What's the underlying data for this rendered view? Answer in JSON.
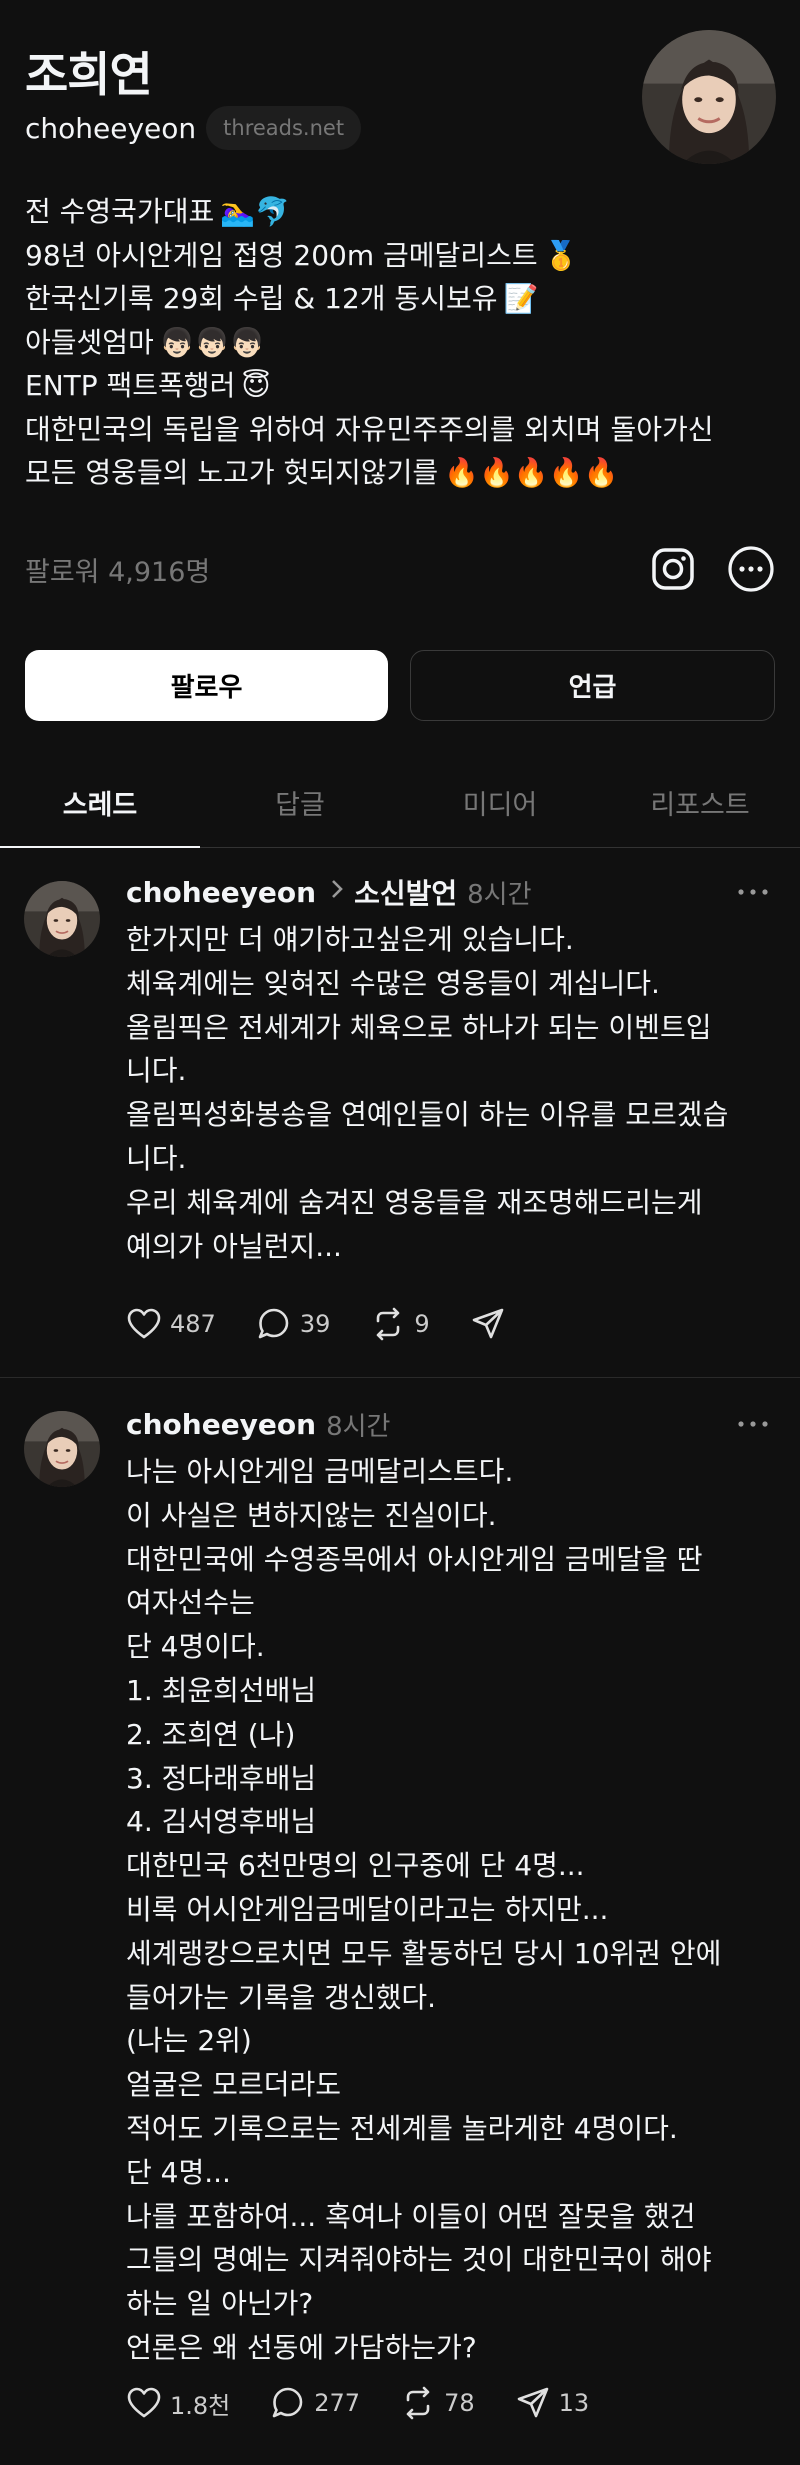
{
  "profile": {
    "name": "조희연",
    "handle": "choheeyeon",
    "domain": "threads.net",
    "bio": [
      {
        "text": "전 수영국가대표",
        "emoji": "🏊‍♀️🐬"
      },
      {
        "text": "98년 아시안게임 접영 200m 금메달리스트",
        "emoji": "🥇"
      },
      {
        "text": "한국신기록 29회 수립 & 12개 동시보유",
        "emoji": "📝"
      },
      {
        "text": "아들셋엄마",
        "emoji": "👦🏻👦🏻👦🏻"
      },
      {
        "text": "ENTP 팩트폭행러",
        "emoji": "😇"
      },
      {
        "text": "대한민국의 독립을 위하여 자유민주주의를 외치며 돌아가신",
        "emoji": ""
      },
      {
        "text": "모든 영웅들의 노고가 헛되지않기를",
        "emoji": "🔥🔥🔥🔥🔥"
      }
    ],
    "followers": "팔로워 4,916명"
  },
  "buttons": {
    "follow": "팔로우",
    "mention": "언급"
  },
  "tabs": [
    "스레드",
    "답글",
    "미디어",
    "리포스트"
  ],
  "posts": [
    {
      "handle": "choheeyeon",
      "topic": "소신발언",
      "time": "8시간",
      "lines": [
        "한가지만 더 얘기하고싶은게 있습니다.",
        "체육계에는 잊혀진 수많은 영웅들이 계십니다.",
        "올림픽은 전세계가 체육으로 하나가 되는 이벤트입",
        "니다.",
        "올림픽성화봉송을 연예인들이 하는 이유를 모르겠습",
        "니다.",
        "우리 체육계에 숨겨진 영웅들을 재조명해드리는게",
        "예의가 아닐런지..."
      ],
      "likes": "487",
      "comments": "39",
      "reposts": "9",
      "shares": ""
    },
    {
      "handle": "choheeyeon",
      "topic": "",
      "time": "8시간",
      "lines": [
        "나는 아시안게임 금메달리스트다.",
        "이 사실은 변하지않는 진실이다.",
        "대한민국에 수영종목에서 아시안게임 금메달을 딴",
        "여자선수는",
        "단 4명이다.",
        "1. 최윤희선배님",
        "2. 조희연 (나)",
        "3. 정다래후배님",
        "4. 김서영후배님",
        "대한민국 6천만명의 인구중에 단 4명...",
        "비록 어시안게임금메달이라고는 하지만...",
        "세계랭캉으로치면 모두 활동하던 당시 10위권 안에",
        "들어가는 기록을 갱신했다.",
        "(나는 2위)",
        "얼굴은 모르더라도",
        "적어도 기록으로는 전세계를 놀라게한 4명이다.",
        "단 4명...",
        "나를 포함하여... 혹여나 이들이 어떤 잘못을 했건",
        "그들의 명예는 지켜줘야하는 것이 대한민국이 해야",
        "하는 일 아닌가?",
        "언론은 왜 선동에 가담하는가?"
      ],
      "likes": "1.8천",
      "comments": "277",
      "reposts": "78",
      "shares": "13"
    }
  ],
  "colors": {
    "background": "#101010",
    "text_primary": "#f3f5f7",
    "text_secondary": "#777777",
    "follow_button_bg": "#ffffff",
    "border": "#3a3a3a"
  },
  "icons": [
    "instagram-icon",
    "more-options-icon",
    "chevron-right-icon",
    "heart-icon",
    "comment-icon",
    "repost-icon",
    "share-icon"
  ]
}
